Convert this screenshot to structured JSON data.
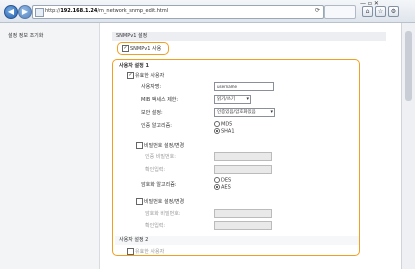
{
  "browser": {
    "url_prefix": "http://",
    "url_host": "192.168.1.24",
    "url_path": "/m_network_snmp_edit.html",
    "back_glyph": "◀",
    "forward_glyph": "▶",
    "toolbar_icons": [
      "home-icon",
      "star-icon",
      "gear-icon"
    ]
  },
  "sidebar": {
    "link_label": "설정 정보 조기화"
  },
  "section_v1": {
    "title": "SNMPv1 설정",
    "checkbox_label": "SNMPv1 사용"
  },
  "user1": {
    "title": "사용자 설정 1",
    "enable_label": "유효한 사용자",
    "username_label": "사용자명:",
    "username_value": "username",
    "mib_label": "MIB 액세스 제한:",
    "mib_value": "읽기/쓰기",
    "security_label": "보안 설정:",
    "security_value": "인증있음/암호화있음",
    "auth_algo_label": "인증 알고리즘:",
    "auth_opt1": "MD5",
    "auth_opt2": "SHA1",
    "auth_pw_set_label": "비밀번호 설정/변경",
    "auth_pw_label": "인증 비밀번호:",
    "confirm_label1": "확인입력:",
    "enc_algo_label": "암호화 알고리즘:",
    "enc_opt1": "DES",
    "enc_opt2": "AES",
    "enc_pw_set_label": "비밀번호 설정/변경",
    "enc_pw_label": "암호화 비밀번호:",
    "confirm_label2": "확인입력:"
  },
  "user2": {
    "title": "사용자 설정 2",
    "enable_label": "유효한 사용자"
  }
}
